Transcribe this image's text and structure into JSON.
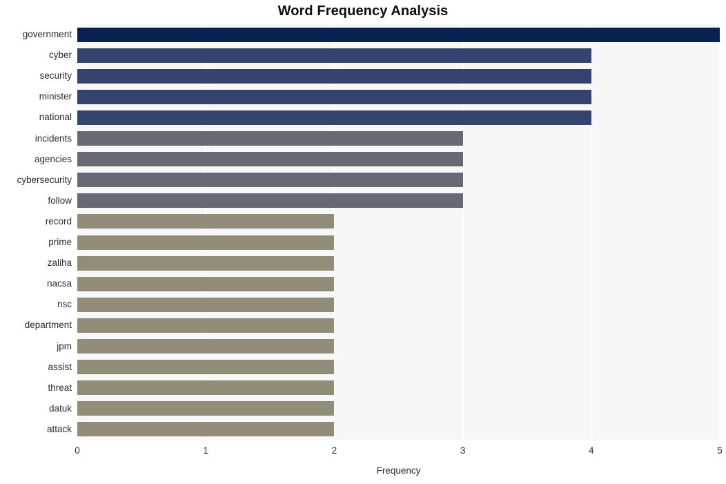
{
  "chart_data": {
    "type": "bar",
    "orientation": "horizontal",
    "title": "Word Frequency Analysis",
    "xlabel": "Frequency",
    "ylabel": "",
    "xlim": [
      0,
      5
    ],
    "xticks": [
      0,
      1,
      2,
      3,
      4,
      5
    ],
    "xtick_labels": [
      "0",
      "1",
      "2",
      "3",
      "4",
      "5"
    ],
    "grid": true,
    "grid_axis": "x",
    "legend": null,
    "categories": [
      "government",
      "cyber",
      "security",
      "minister",
      "national",
      "incidents",
      "agencies",
      "cybersecurity",
      "follow",
      "record",
      "prime",
      "zaliha",
      "nacsa",
      "nsc",
      "department",
      "jpm",
      "assist",
      "threat",
      "datuk",
      "attack"
    ],
    "values": [
      5,
      4,
      4,
      4,
      4,
      3,
      3,
      3,
      3,
      2,
      2,
      2,
      2,
      2,
      2,
      2,
      2,
      2,
      2,
      2
    ],
    "bar_colors": [
      "#0a2050",
      "#35446e",
      "#35446e",
      "#35446e",
      "#35446e",
      "#676a74",
      "#676a74",
      "#676a74",
      "#676a74",
      "#918d78",
      "#918d78",
      "#918d78",
      "#918d78",
      "#918d78",
      "#918d78",
      "#918d78",
      "#918d78",
      "#918d78",
      "#918d78",
      "#918d78"
    ]
  },
  "style": {
    "plot_background": "#f7f7f7",
    "gridline_color": "#ffffff",
    "figure_background": "#ffffff",
    "title_color": "#0d0d14",
    "tick_color": "#2b2b2b"
  }
}
